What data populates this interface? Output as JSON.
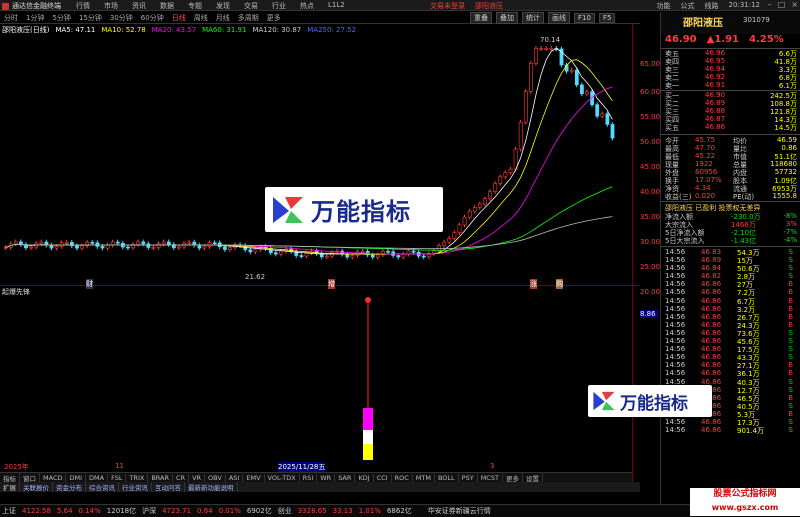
{
  "menubar": {
    "app_title": "通达信金融终端",
    "menus": [
      "行情",
      "市场",
      "资讯",
      "数据",
      "专题",
      "发现",
      "交易",
      "行业",
      "热点",
      "L1L2"
    ],
    "warn_login": "交易未登录",
    "warn_stock": "邵阳液压",
    "right": [
      "功能",
      "公式",
      "线路"
    ],
    "time": "20:31:12"
  },
  "periodbar": {
    "items": [
      "分时",
      "1分钟",
      "5分钟",
      "15分钟",
      "30分钟",
      "60分钟",
      "日线",
      "周线",
      "月线",
      "多周期",
      "更多"
    ],
    "active": "日线"
  },
  "right_tools": [
    "重叠",
    "叠加",
    "统计",
    "画线",
    "F10",
    "F5"
  ],
  "ma_line": {
    "name": "邵阳液压(日线)",
    "items": [
      {
        "label": "MA5: 47.11",
        "color": "#ffffff"
      },
      {
        "label": "MA10: 52.78",
        "color": "#ffff00"
      },
      {
        "label": "MA20: 43.57",
        "color": "#ff00ff"
      },
      {
        "label": "MA60: 31.91",
        "color": "#00ff00"
      },
      {
        "label": "MA120: 30.87",
        "color": "#cccccc"
      },
      {
        "label": "MA250: 27.52",
        "color": "#4a6aff"
      }
    ]
  },
  "chart_data": {
    "type": "candlestick",
    "high_label": "70.14",
    "low_label": "21.62",
    "axis_labels": [
      "65.00",
      "60.00",
      "55.00",
      "50.00",
      "45.00",
      "40.00",
      "35.00",
      "30.00",
      "25.00",
      "20.00"
    ],
    "indicator_name": "起爆先锋",
    "indicator_value": "8.86",
    "markers": [
      "财",
      "增",
      "涨",
      "购"
    ]
  },
  "xlabels": {
    "left": "2025年",
    "mid": "2025/11/28五",
    "right": "11",
    "far": "3"
  },
  "bottomtabs": [
    "指标",
    "窗口",
    "MACD",
    "DMI",
    "DMA",
    "FSL",
    "TRIX",
    "BRAR",
    "CR",
    "VR",
    "OBV",
    "ASI",
    "EMV",
    "VOL-TDX",
    "RSI",
    "WR",
    "SAR",
    "KDJ",
    "CCI",
    "ROC",
    "MTM",
    "BOLL",
    "PSY",
    "MCST",
    "更多",
    "设置"
  ],
  "bottomtabs2": [
    "扩展",
    "关联报价",
    "资金分布",
    "综合资讯",
    "行业资讯",
    "互动问答",
    "最新新功能说明"
  ],
  "stock": {
    "name": "邵阳液压",
    "code": "301079",
    "price": "46.90",
    "change": "▲1.91",
    "pct": "4.25%"
  },
  "orderbook": {
    "asks": [
      {
        "label": "卖五",
        "price": "46.96",
        "vol": "6.6万"
      },
      {
        "label": "卖四",
        "price": "46.95",
        "vol": "41.8万"
      },
      {
        "label": "卖三",
        "price": "46.94",
        "vol": "3.3万"
      },
      {
        "label": "卖二",
        "price": "46.92",
        "vol": "6.8万"
      },
      {
        "label": "卖一",
        "price": "46.91",
        "vol": "6.1万"
      }
    ],
    "bids": [
      {
        "label": "买一",
        "price": "46.90",
        "vol": "242.5万"
      },
      {
        "label": "买二",
        "price": "46.89",
        "vol": "108.8万"
      },
      {
        "label": "买三",
        "price": "46.88",
        "vol": "121.8万"
      },
      {
        "label": "买四",
        "price": "46.87",
        "vol": "14.3万"
      },
      {
        "label": "买五",
        "price": "46.86",
        "vol": "14.5万"
      }
    ]
  },
  "stats": [
    {
      "l1": "今开",
      "v1": "45.75",
      "l2": "均价",
      "v2": "46.59"
    },
    {
      "l1": "最高",
      "v1": "47.70",
      "l2": "量比",
      "v2": "0.86"
    },
    {
      "l1": "最低",
      "v1": "45.22",
      "l2": "市值",
      "v2": "51.1亿"
    },
    {
      "l1": "现量",
      "v1": "1922",
      "l2": "总量",
      "v2": "118680"
    },
    {
      "l1": "外盘",
      "v1": "60956",
      "l2": "内盘",
      "v2": "57732"
    },
    {
      "l1": "换手",
      "v1": "17.07%",
      "l2": "股本",
      "v2": "1.09亿"
    },
    {
      "l1": "净资",
      "v1": "4.34",
      "l2": "流通",
      "v2": "6953万"
    },
    {
      "l1": "收益(三)",
      "v1": "0.020",
      "l2": "PE(动)",
      "v2": "1555.8"
    }
  ],
  "notice": "邵阳液压 已盈利 投票权无差异",
  "flows": [
    {
      "label": "净流入额",
      "v": "-230.0万",
      "p": "-8%"
    },
    {
      "label": "大宗流入",
      "v": "1466万",
      "p": "3%"
    },
    {
      "label": "5日净流入额",
      "v": "-2.10亿",
      "p": "-7%"
    },
    {
      "label": "5日大宗流入",
      "v": "-1.43亿",
      "p": "-4%"
    }
  ],
  "trades": [
    {
      "t": "14:56",
      "p": "46.83",
      "v": "54.3万",
      "d": "S"
    },
    {
      "t": "14:56",
      "p": "46.89",
      "v": "15万",
      "d": "S"
    },
    {
      "t": "14:56",
      "p": "46.84",
      "v": "50.6万",
      "d": "S"
    },
    {
      "t": "14:56",
      "p": "46.82",
      "v": "2.8万",
      "d": "S"
    },
    {
      "t": "14:56",
      "p": "46.86",
      "v": "27万",
      "d": "B"
    },
    {
      "t": "14:56",
      "p": "46.86",
      "v": "7.2万",
      "d": "B"
    },
    {
      "t": "14:56",
      "p": "46.86",
      "v": "6.7万",
      "d": "B"
    },
    {
      "t": "14:56",
      "p": "46.86",
      "v": "3.2万",
      "d": "B"
    },
    {
      "t": "14:56",
      "p": "46.86",
      "v": "26.7万",
      "d": "B"
    },
    {
      "t": "14:56",
      "p": "46.86",
      "v": "24.3万",
      "d": "B"
    },
    {
      "t": "14:56",
      "p": "46.86",
      "v": "73.6万",
      "d": "S"
    },
    {
      "t": "14:56",
      "p": "46.86",
      "v": "45.6万",
      "d": "S"
    },
    {
      "t": "14:56",
      "p": "46.86",
      "v": "17.5万",
      "d": "S"
    },
    {
      "t": "14:56",
      "p": "46.86",
      "v": "43.3万",
      "d": "S"
    },
    {
      "t": "14:56",
      "p": "46.86",
      "v": "27.1万",
      "d": "B"
    },
    {
      "t": "14:56",
      "p": "46.86",
      "v": "36.1万",
      "d": "B"
    },
    {
      "t": "14:56",
      "p": "46.86",
      "v": "40.3万",
      "d": "S"
    },
    {
      "t": "14:56",
      "p": "46.86",
      "v": "12.7万",
      "d": "S"
    },
    {
      "t": "14:56",
      "p": "46.86",
      "v": "46.5万",
      "d": "B"
    },
    {
      "t": "14:56",
      "p": "46.86",
      "v": "40.5万",
      "d": "S"
    },
    {
      "t": "14:56",
      "p": "46.86",
      "v": "5.3万",
      "d": "B"
    },
    {
      "t": "14:56",
      "p": "46.86",
      "v": "17.3万",
      "d": "S"
    },
    {
      "t": "14:56",
      "p": "46.86",
      "v": "901.4万",
      "d": "S"
    }
  ],
  "statusbar": [
    {
      "label": "上证",
      "v": "4122.58",
      "c": "5.64",
      "p": "0.14%",
      "amt": "12018亿"
    },
    {
      "label": "沪深",
      "v": "4723.71",
      "c": "0.64",
      "p": "0.01%",
      "amt": "6902亿"
    },
    {
      "label": "创业",
      "v": "3328.65",
      "c": "33.13",
      "p": "1.01%",
      "amt": "6862亿"
    }
  ],
  "status_right": "华安证券新疆云行情",
  "logo_text": "万能指标",
  "watermark": {
    "title": "股票公式指标网",
    "url": "www.gszx.com"
  }
}
